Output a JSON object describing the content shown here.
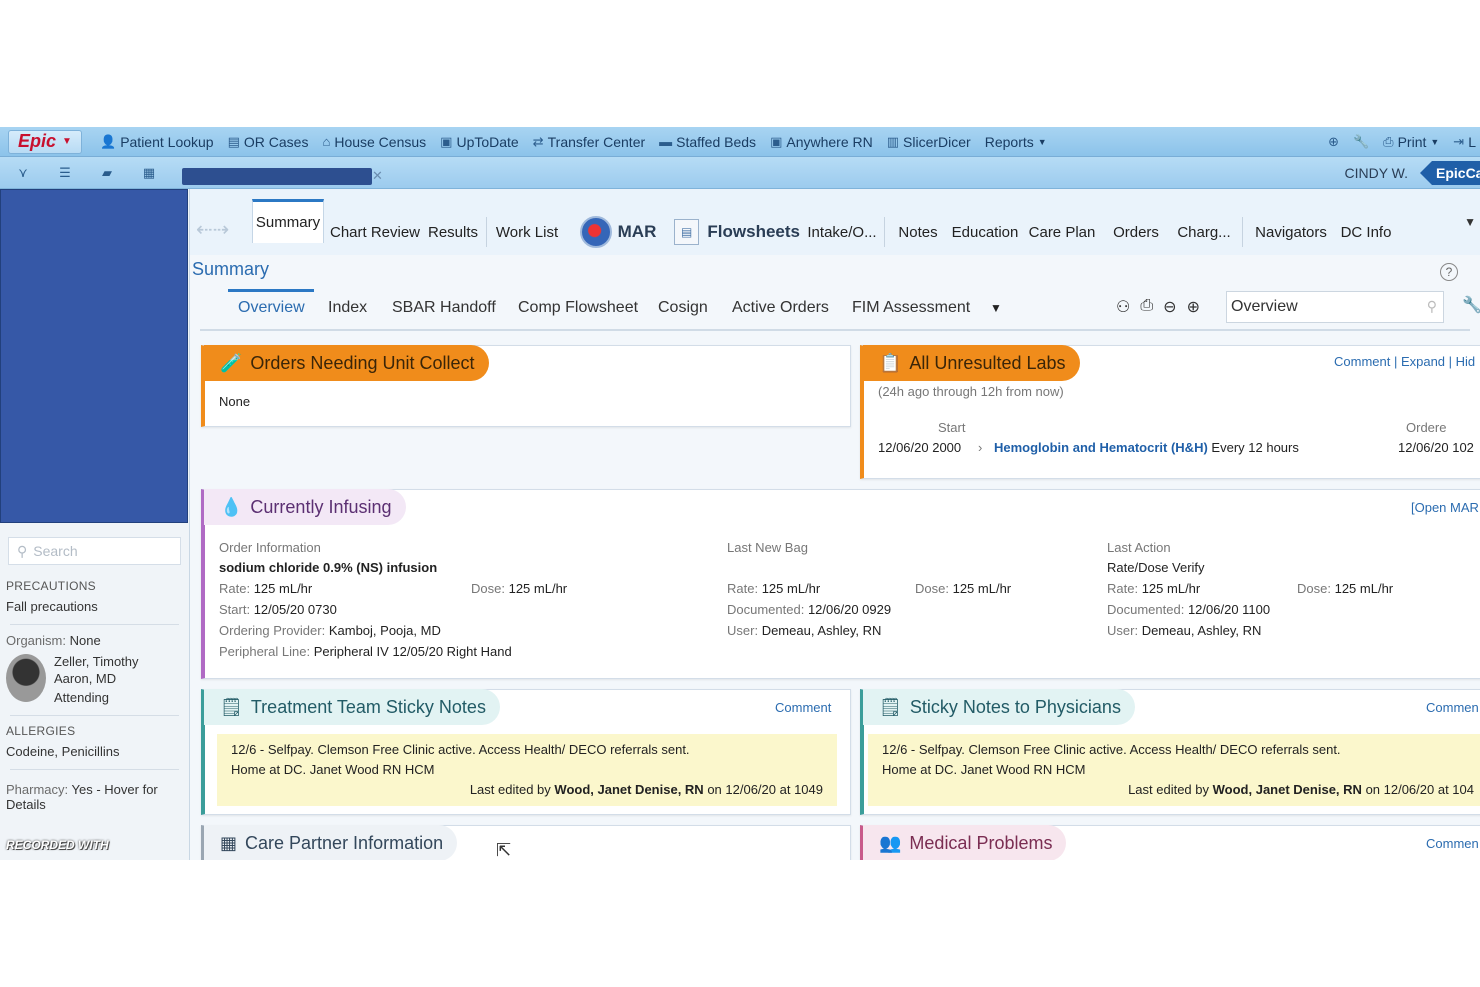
{
  "toolbar": {
    "epic_label": "Epic",
    "items": [
      "Patient Lookup",
      "OR Cases",
      "House Census",
      "UpToDate",
      "Transfer Center",
      "Staffed Beds",
      "Anywhere RN",
      "SlicerDicer",
      "Reports"
    ],
    "print_label": "Print",
    "logout_label": "L"
  },
  "session": {
    "user": "CINDY W.",
    "app": "EpicCa"
  },
  "sidebar": {
    "search_placeholder": "Search",
    "precautions_head": "PRECAUTIONS",
    "precautions_value": "Fall precautions",
    "organism_label": "Organism:",
    "organism_value": "None",
    "physician_name_1": "Zeller, Timothy",
    "physician_name_2": "Aaron, MD",
    "physician_role": "Attending",
    "allergies_head": "ALLERGIES",
    "allergies_value": "Codeine, Penicillins",
    "pharmacy_label": "Pharmacy:",
    "pharmacy_value": "Yes - Hover for",
    "pharmacy_value_2": "Details",
    "watermark": "RECORDED WITH"
  },
  "activity_tabs": [
    "Summary",
    "Chart Review",
    "Results",
    "Work List",
    "MAR",
    "Flowsheets",
    "Intake/O...",
    "Notes",
    "Education",
    "Care Plan",
    "Orders",
    "Charg...",
    "Navigators",
    "DC Info"
  ],
  "summary": {
    "title": "Summary",
    "subtabs": [
      "Overview",
      "Index",
      "SBAR Handoff",
      "Comp Flowsheet",
      "Cosign",
      "Active Orders",
      "FIM Assessment"
    ],
    "view_value": "Overview"
  },
  "orders_unit_collect": {
    "title": "Orders Needing Unit Collect",
    "value": "None"
  },
  "unresulted_labs": {
    "title": "All Unresulted Labs",
    "range": "(24h ago through 12h from now)",
    "links": "Comment | Expand | Hid",
    "start_head": "Start",
    "ordered_head": "Ordere",
    "start_value": "12/06/20 2000",
    "lab_name": "Hemoglobin and Hematocrit (H&H)",
    "frequency": "Every 12 hours",
    "ordered_value": "12/06/20 102"
  },
  "infusing": {
    "title": "Currently Infusing",
    "open_mar": "[Open MAR",
    "order_head": "Order Information",
    "drug": "sodium chloride 0.9% (NS) infusion",
    "rate_label": "Rate:",
    "rate_value": "125 mL/hr",
    "dose_label": "Dose:",
    "dose_value": "125 mL/hr",
    "start_label": "Start:",
    "start_value": "12/05/20 0730",
    "provider_label": "Ordering Provider:",
    "provider_value": "Kamboj, Pooja, MD",
    "line_label": "Peripheral Line:",
    "line_value": "Peripheral IV 12/05/20 Right Hand",
    "bag_head": "Last New Bag",
    "bag_rate": "125 mL/hr",
    "bag_dose": "125 mL/hr",
    "documented_label": "Documented:",
    "bag_documented": "12/06/20 0929",
    "user_label": "User:",
    "bag_user": "Demeau, Ashley, RN",
    "action_head": "Last Action",
    "action_value": "Rate/Dose Verify",
    "action_rate": "125 mL/hr",
    "action_dose": "125 mL/hr",
    "action_documented": "12/06/20 1100",
    "action_user": "Demeau, Ashley, RN"
  },
  "team_notes": {
    "title": "Treatment Team Sticky Notes",
    "comment": "Comment",
    "line1": "12/6 - Selfpay.  Clemson Free Clinic active. Access Health/ DECO referrals sent.",
    "line2": "Home at DC.  Janet Wood RN HCM",
    "edited_prefix": "Last edited by",
    "edited_by": "Wood, Janet Denise, RN",
    "edited_suffix": "on 12/06/20 at 1049"
  },
  "physician_notes": {
    "title": "Sticky Notes to Physicians",
    "comment": "Commen",
    "line1": "12/6 - Selfpay.  Clemson Free Clinic active. Access Health/ DECO referrals sent.",
    "line2": "Home at DC.  Janet Wood RN HCM",
    "edited_prefix": "Last edited by",
    "edited_by": "Wood, Janet Denise, RN",
    "edited_suffix": "on 12/06/20 at 104"
  },
  "care_partner": {
    "title": "Care Partner Information"
  },
  "medical_problems": {
    "title": "Medical Problems",
    "comment": "Commen"
  }
}
